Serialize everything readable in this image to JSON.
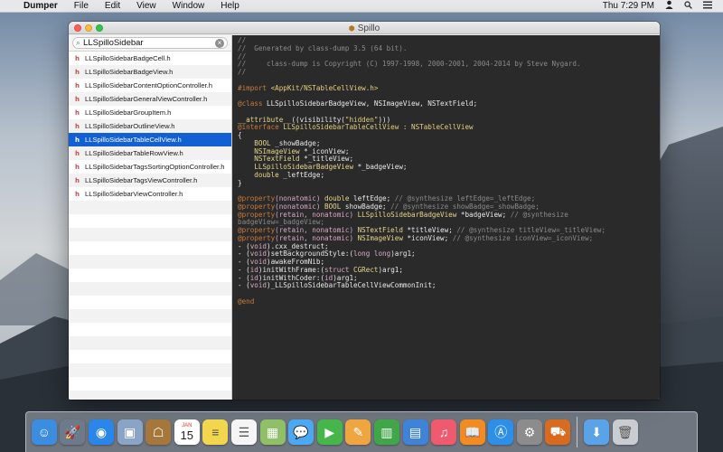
{
  "menubar": {
    "apple_glyph": "",
    "app_name": "Dumper",
    "items": [
      "File",
      "Edit",
      "View",
      "Window",
      "Help"
    ],
    "clock": "Thu 7:29 PM"
  },
  "window": {
    "title": "Spillo"
  },
  "search": {
    "value": "LLSpilloSidebar"
  },
  "files": [
    "LLSpilloSidebarBadgeCell.h",
    "LLSpilloSidebarBadgeView.h",
    "LLSpilloSidebarContentOptionController.h",
    "LLSpilloSidebarGeneralViewController.h",
    "LLSpilloSidebarGroupItem.h",
    "LLSpilloSidebarOutlineView.h",
    "LLSpilloSidebarTableCellView.h",
    "LLSpilloSidebarTableRowView.h",
    "LLSpilloSidebarTagsSortingOptionController.h",
    "LLSpilloSidebarTagsViewController.h",
    "LLSpilloSidebarViewController.h"
  ],
  "selected_file_index": 6,
  "code": {
    "l1": "//",
    "l2": "//  Generated by class-dump 3.5 (64 bit).",
    "l3": "//",
    "l4": "//     class-dump is Copyright (C) 1997-1998, 2000-2001, 2004-2014 by Steve Nygard.",
    "l5": "//",
    "import_kw": "#import ",
    "import_path": "<AppKit/NSTableCellView.h>",
    "class_kw": "@class",
    "class_list": " LLSpilloSidebarBadgeView, NSImageView, NSTextField;",
    "attr_kw": "__attribute__",
    "attr_rest": "((visibility(",
    "attr_str": "\"hidden\"",
    "attr_end": ")))",
    "interface_kw": "@interface",
    "interface_rest": " LLSpilloSidebarTableCellView : NSTableCellView",
    "brace_open": "{",
    "iv1_type": "BOOL",
    "iv1_name": " _showBadge;",
    "iv2_type": "NSImageView",
    "iv2_name": " *_iconView;",
    "iv3_type": "NSTextField",
    "iv3_name": " *_titleView;",
    "iv4_type": "LLSpilloSidebarBadgeView",
    "iv4_name": " *_badgeView;",
    "iv5_type": "double",
    "iv5_name": " _leftEdge;",
    "brace_close": "}",
    "p1_kw": "@property",
    "p1_attr": "(nonatomic)",
    "p1_type": " double",
    "p1_name": " leftEdge;",
    "p1_com": " // @synthesize leftEdge=_leftEdge;",
    "p2_kw": "@property",
    "p2_attr": "(nonatomic)",
    "p2_type": " BOOL",
    "p2_name": " showBadge;",
    "p2_com": " // @synthesize showBadge=_showBadge;",
    "p3_kw": "@property",
    "p3_attr": "(retain, nonatomic)",
    "p3_type": " LLSpilloSidebarBadgeView",
    "p3_name": " *badgeView;",
    "p3_com": " // @synthesize",
    "p3_com2": "badgeView=_badgeView;",
    "p4_kw": "@property",
    "p4_attr": "(retain, nonatomic)",
    "p4_type": " NSTextField",
    "p4_name": " *titleView;",
    "p4_com": " // @synthesize titleView=_titleView;",
    "p5_kw": "@property",
    "p5_attr": "(retain, nonatomic)",
    "p5_type": " NSImageView",
    "p5_name": " *iconView;",
    "p5_com": " // @synthesize iconView=_iconView;",
    "m1_a": "- (",
    "m1_t": "void",
    "m1_b": ").cxx_destruct;",
    "m2_a": "- (",
    "m2_t": "void",
    "m2_b": ")setBackgroundStyle:(",
    "m2_t2": "long long",
    "m2_c": ")arg1;",
    "m3_a": "- (",
    "m3_t": "void",
    "m3_b": ")awakeFromNib;",
    "m4_a": "- (",
    "m4_t": "id",
    "m4_b": ")initWithFrame:(",
    "m4_t2": "struct",
    "m4_t3": " CGRect",
    "m4_c": ")arg1;",
    "m5_a": "- (",
    "m5_t": "id",
    "m5_b": ")initWithCoder:(",
    "m5_t2": "id",
    "m5_c": ")arg1;",
    "m6_a": "- (",
    "m6_t": "void",
    "m6_b": ")_LLSpilloSidebarTableCellViewCommonInit;",
    "end_kw": "@end"
  },
  "dock": {
    "calendar_month": "JAN",
    "calendar_day": "15",
    "apps": [
      {
        "name": "finder-icon",
        "glyph": "☺",
        "color": "#3b8de0"
      },
      {
        "name": "launchpad-icon",
        "glyph": "🚀",
        "color": "#6d7a8a"
      },
      {
        "name": "safari-icon",
        "glyph": "◉",
        "color": "#2a86e8"
      },
      {
        "name": "preview-icon",
        "glyph": "▣",
        "color": "#8aa4c6"
      },
      {
        "name": "contacts-icon",
        "glyph": "☖",
        "color": "#a6773b"
      },
      {
        "name": "calendar-icon",
        "glyph": "",
        "color": "#ffffff"
      },
      {
        "name": "notes-icon",
        "glyph": "≡",
        "color": "#f2d74e"
      },
      {
        "name": "reminders-icon",
        "glyph": "☰",
        "color": "#f5f5f5"
      },
      {
        "name": "photo-booth-icon",
        "glyph": "▦",
        "color": "#8fbf66"
      },
      {
        "name": "messages-icon",
        "glyph": "💬",
        "color": "#4ba8f2"
      },
      {
        "name": "facetime-icon",
        "glyph": "▶",
        "color": "#46b64b"
      },
      {
        "name": "pages-icon",
        "glyph": "✎",
        "color": "#f0a640"
      },
      {
        "name": "numbers-icon",
        "glyph": "▥",
        "color": "#40a648"
      },
      {
        "name": "keynote-icon",
        "glyph": "▤",
        "color": "#3f83d9"
      },
      {
        "name": "itunes-icon",
        "glyph": "♫",
        "color": "#f05a6e"
      },
      {
        "name": "ibooks-icon",
        "glyph": "📖",
        "color": "#f28b22"
      },
      {
        "name": "app-store-icon",
        "glyph": "Ⓐ",
        "color": "#2e8fe8"
      },
      {
        "name": "system-preferences-icon",
        "glyph": "⚙",
        "color": "#8c8c8c"
      },
      {
        "name": "dumper-icon",
        "glyph": "⛟",
        "color": "#d86b1f"
      }
    ],
    "downloads": {
      "name": "downloads-folder-icon",
      "glyph": "⬇",
      "color": "#5aa3e8"
    },
    "trash": {
      "name": "trash-icon",
      "glyph": "🗑",
      "color": "#c9cdd2"
    }
  }
}
